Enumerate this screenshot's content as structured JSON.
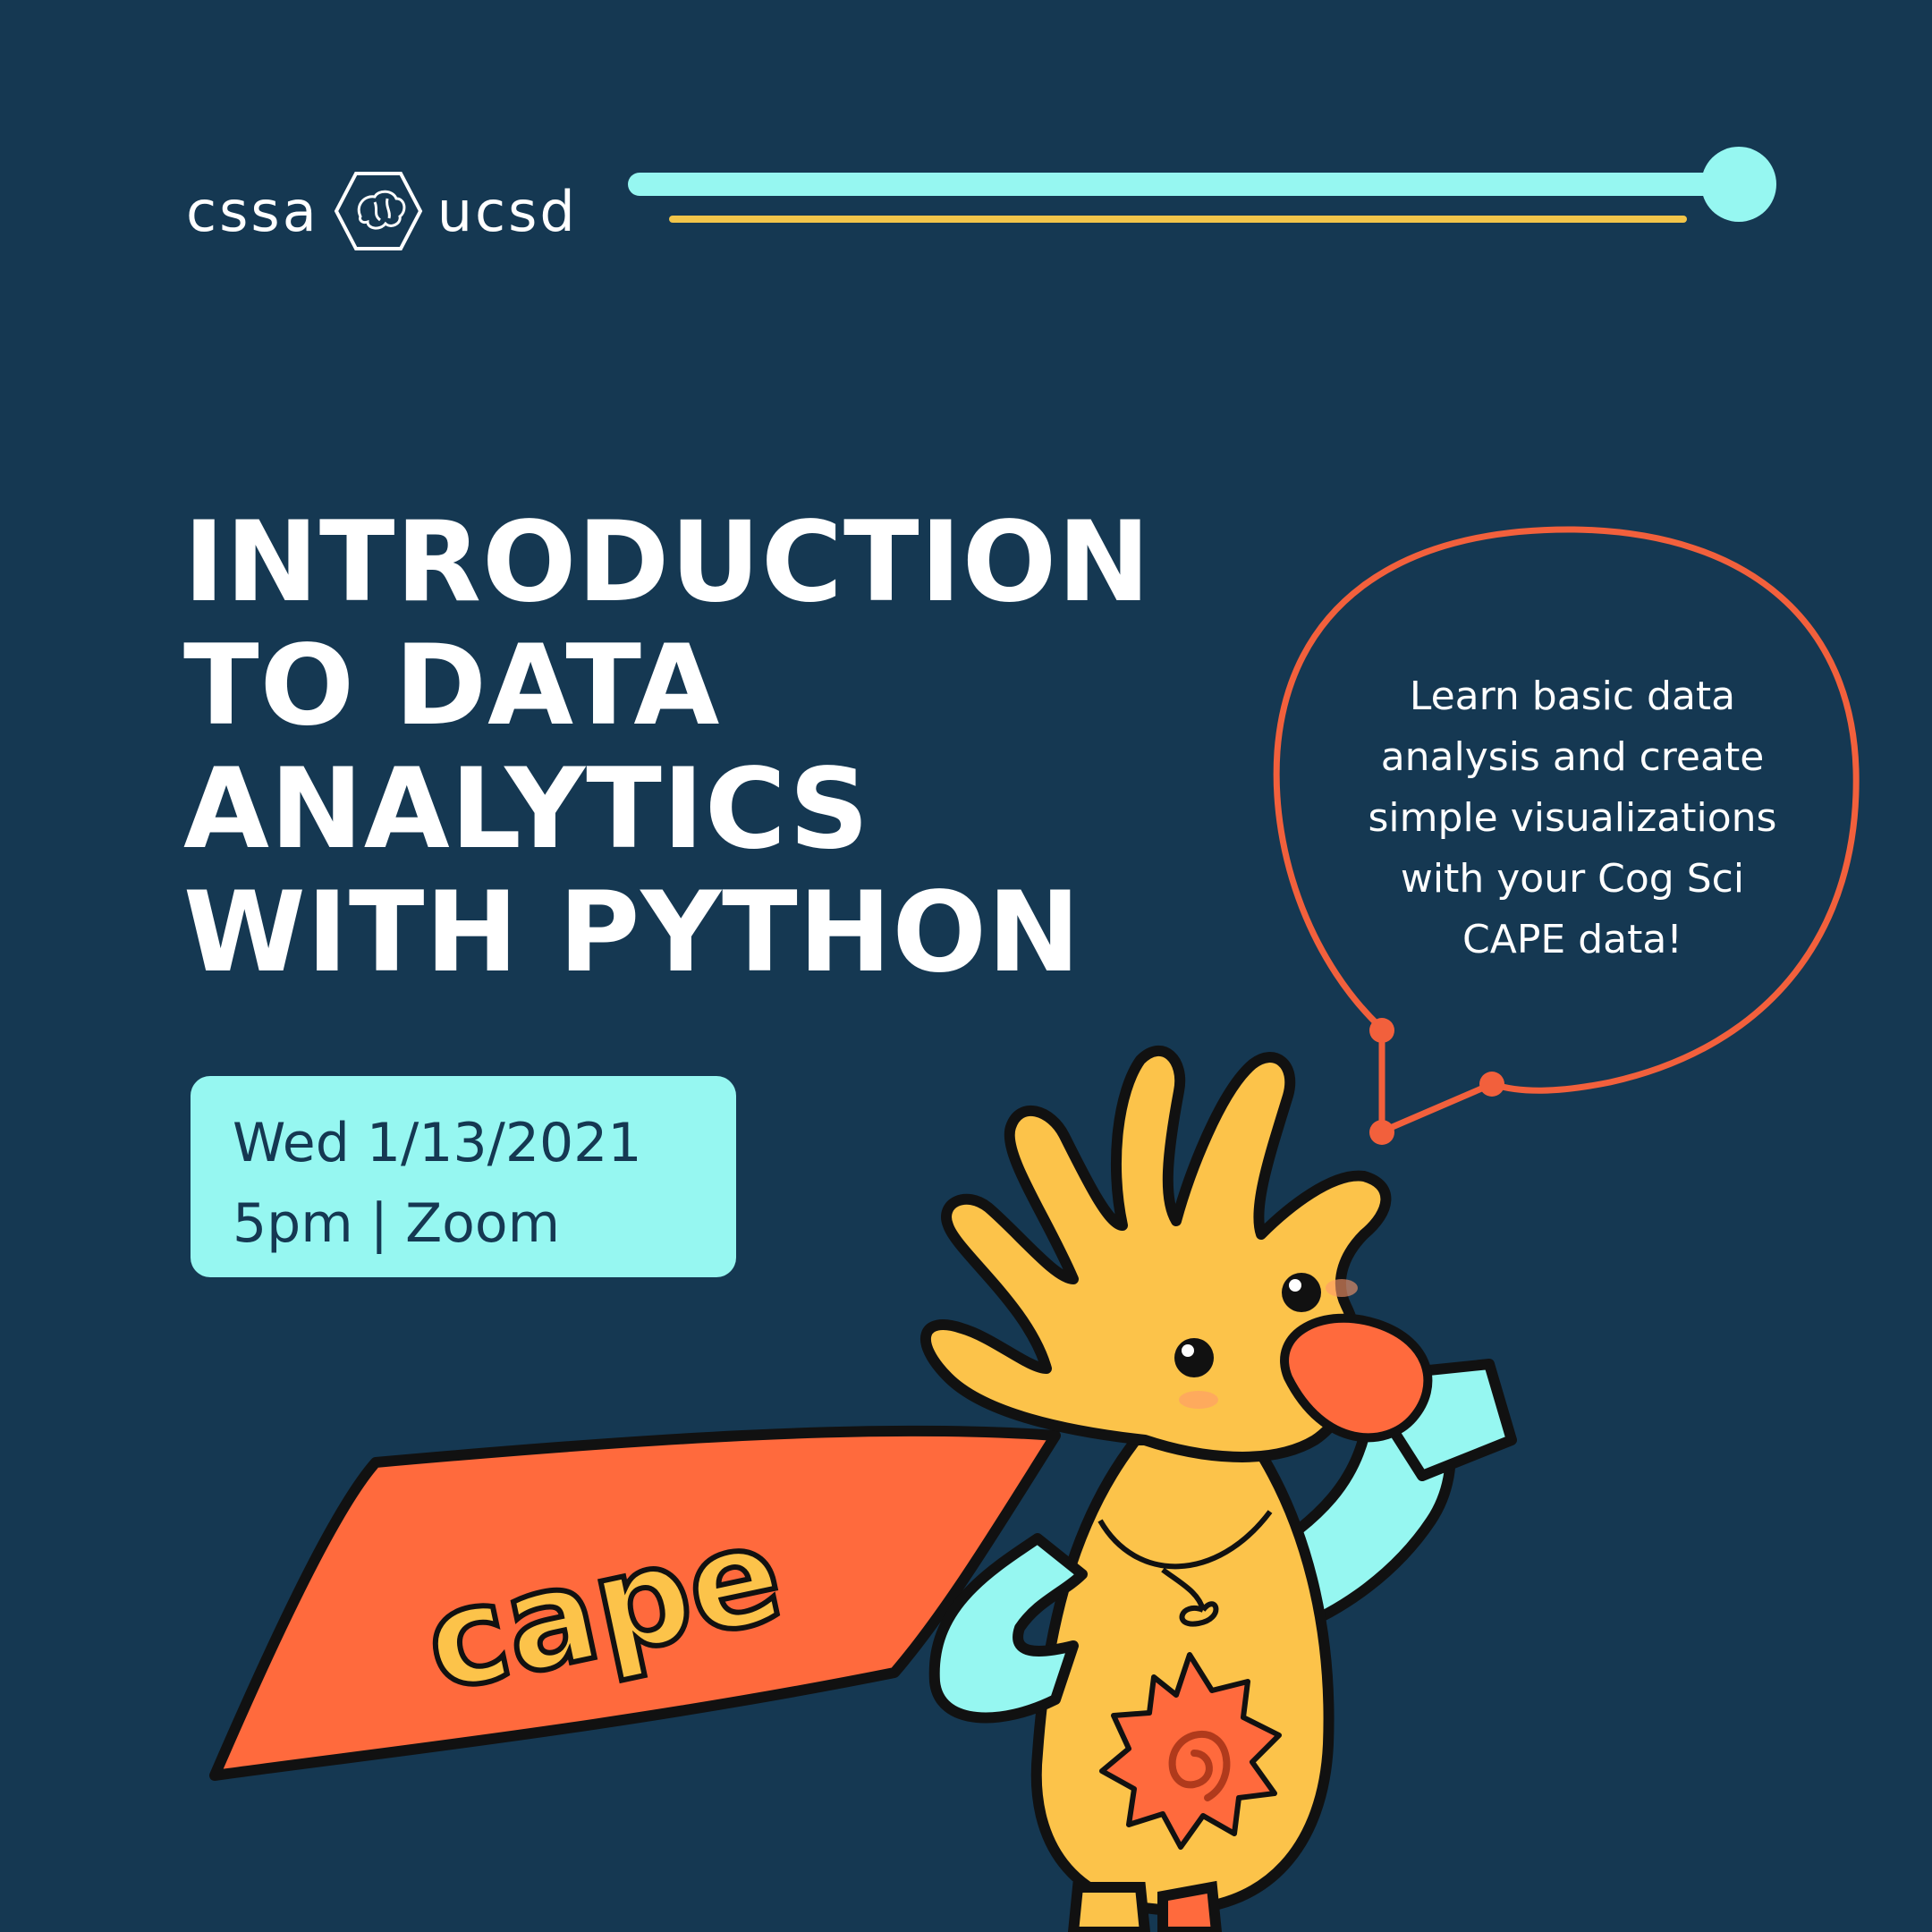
{
  "brand": {
    "left_text": "cssa",
    "right_text": "ucsd",
    "logo_icon": "brain-hexagon-icon"
  },
  "title_lines": [
    "INTRODUCTION",
    "TO DATA",
    "ANALYTICS",
    "WITH PYTHON"
  ],
  "event": {
    "date": "Wed 1/13/2021",
    "time_location": "5pm | Zoom"
  },
  "speech_bubble_lines": [
    "Learn basic data",
    "analysis and create",
    "simple visualizations",
    "with your Cog Sci",
    "CAPE data!"
  ],
  "mascot": {
    "cape_text": "cape",
    "icon": "superhero-hand-mascot-illustration"
  },
  "colors": {
    "background": "#153852",
    "accent_cyan": "#96f7f1",
    "accent_yellow": "#f2c54a",
    "accent_orange": "#f2603c",
    "text_light": "#ffffff"
  }
}
